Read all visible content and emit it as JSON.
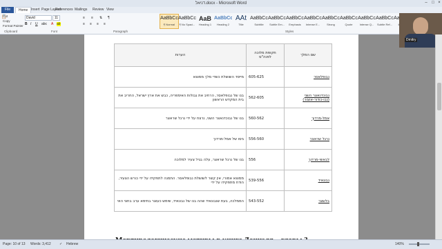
{
  "window": {
    "title": "דניאל.docx - Microsoft Word"
  },
  "tabs": [
    "File",
    "Home",
    "Insert",
    "Page Layout",
    "References",
    "Mailings",
    "Review",
    "View"
  ],
  "clipboard": {
    "cut": "Cut",
    "copy": "Copy",
    "format_painter": "Format Painter",
    "paste": "Paste",
    "group": "Clipboard"
  },
  "font": {
    "name": "David",
    "size": "11",
    "group": "Font"
  },
  "paragraph": {
    "group": "Paragraph"
  },
  "styles": {
    "group": "Styles",
    "items": [
      {
        "sample": "AaBbCc",
        "name": "¶ Normal"
      },
      {
        "sample": "AaBbCc",
        "name": "¶ No Spaci..."
      },
      {
        "sample": "AaB",
        "name": "Heading 1"
      },
      {
        "sample": "AaBbCc",
        "name": "Heading 2"
      },
      {
        "sample": "AAt",
        "name": "Title"
      },
      {
        "sample": "AaBbCc",
        "name": "Subtitle"
      },
      {
        "sample": "AaBbCc",
        "name": "Subtle Em..."
      },
      {
        "sample": "AaBbCc",
        "name": "Emphasis"
      },
      {
        "sample": "AaBbCc",
        "name": "Intense E..."
      },
      {
        "sample": "AaBbCc",
        "name": "Strong"
      },
      {
        "sample": "AaBbCc",
        "name": "Quote"
      },
      {
        "sample": "AaBbCc",
        "name": "Intense Q..."
      },
      {
        "sample": "AaBbCc",
        "name": "Subtle Ref..."
      },
      {
        "sample": "AaBbCc",
        "name": "Intense"
      }
    ]
  },
  "webcam": {
    "caption": "Dmitry"
  },
  "table": {
    "headers": {
      "name": "שם המלך",
      "years": "תקופת מלוכה לפנה\"ס",
      "notes": "הערות"
    },
    "rows": [
      {
        "name": "נבופלאסר",
        "years": "605-625",
        "notes": "מייסד השושלת כשדי מלך ממוצא"
      },
      {
        "name": "נבוכדנאצר השני (נבו-כודור-אוצור)",
        "years": "562-605",
        "notes": "בנו של נבופלאסר, הרחיב את גבולות האימפריה, כבש את ארץ ישראל, החריב את בית המקדש הראשון"
      },
      {
        "name": "אמל-מרדוך",
        "years": "560-562",
        "notes": "בנו של נבוכדנאצר השני, נרצח על ידי נרגל שראצר"
      },
      {
        "name": "נרגל שראצר",
        "years": "556-560",
        "notes": "גיסו של אמל-מרדוך"
      },
      {
        "name": "לבאשי-מרדוך",
        "years": "556",
        "notes": "בנו של נרגל שראצר, עלה בגיל צעיר למלוכה"
      },
      {
        "name": "נבונאיד",
        "years": "539-556",
        "notes": "ממוצא אמורי, אין קשר לשושלת נבופלאסר. התמנה לתפקידו על ידי כורש הצעיר, הודח מתפקידו על ידי"
      },
      {
        "name": "בלשצר",
        "years": "543-552",
        "notes": "הממלכה, בעת שנבונאיד שהה בנו של נבונאיד, שימש כעוצר בתימא ערב בחצי האי"
      }
    ]
  },
  "heading_below": "Мартирологические мотивы в книге Даниэля – главы 3",
  "status": {
    "page": "Page: 10 of 13",
    "words": "Words: 3,412",
    "language": "Hebrew",
    "zoom": "140%"
  }
}
